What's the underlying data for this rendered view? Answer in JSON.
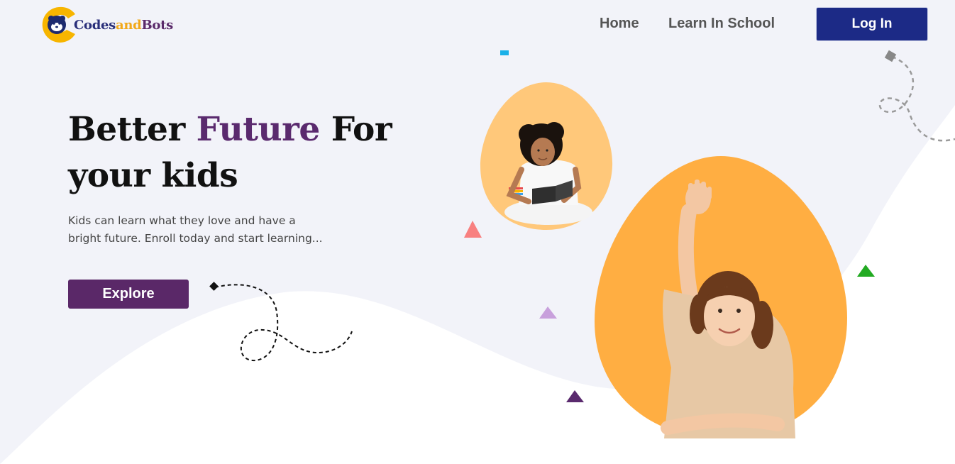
{
  "brand": {
    "name_part1": "Codes",
    "name_part2": "and",
    "name_part3": "Bots"
  },
  "nav": {
    "home": "Home",
    "learn_in_school": "Learn In School",
    "login": "Log In"
  },
  "hero": {
    "title_part1": "Better ",
    "title_accent": "Future",
    "title_part2": " For your kids",
    "description": "Kids can learn what they love and have a bright future. Enroll today and start learning...",
    "cta": "Explore"
  },
  "colors": {
    "background": "#f2f3f9",
    "primary_navy": "#1c2a86",
    "accent_purple": "#5a2868",
    "blob_light": "#ffc87a",
    "blob_orange": "#ffae42",
    "logo_yellow": "#f7b500"
  },
  "decorations": {
    "triangle_colors": [
      "#f88080",
      "#c8a0dc",
      "#5a2a6e",
      "#22aa22"
    ],
    "square_colors": [
      "#1ab0e8",
      "#888888"
    ]
  }
}
